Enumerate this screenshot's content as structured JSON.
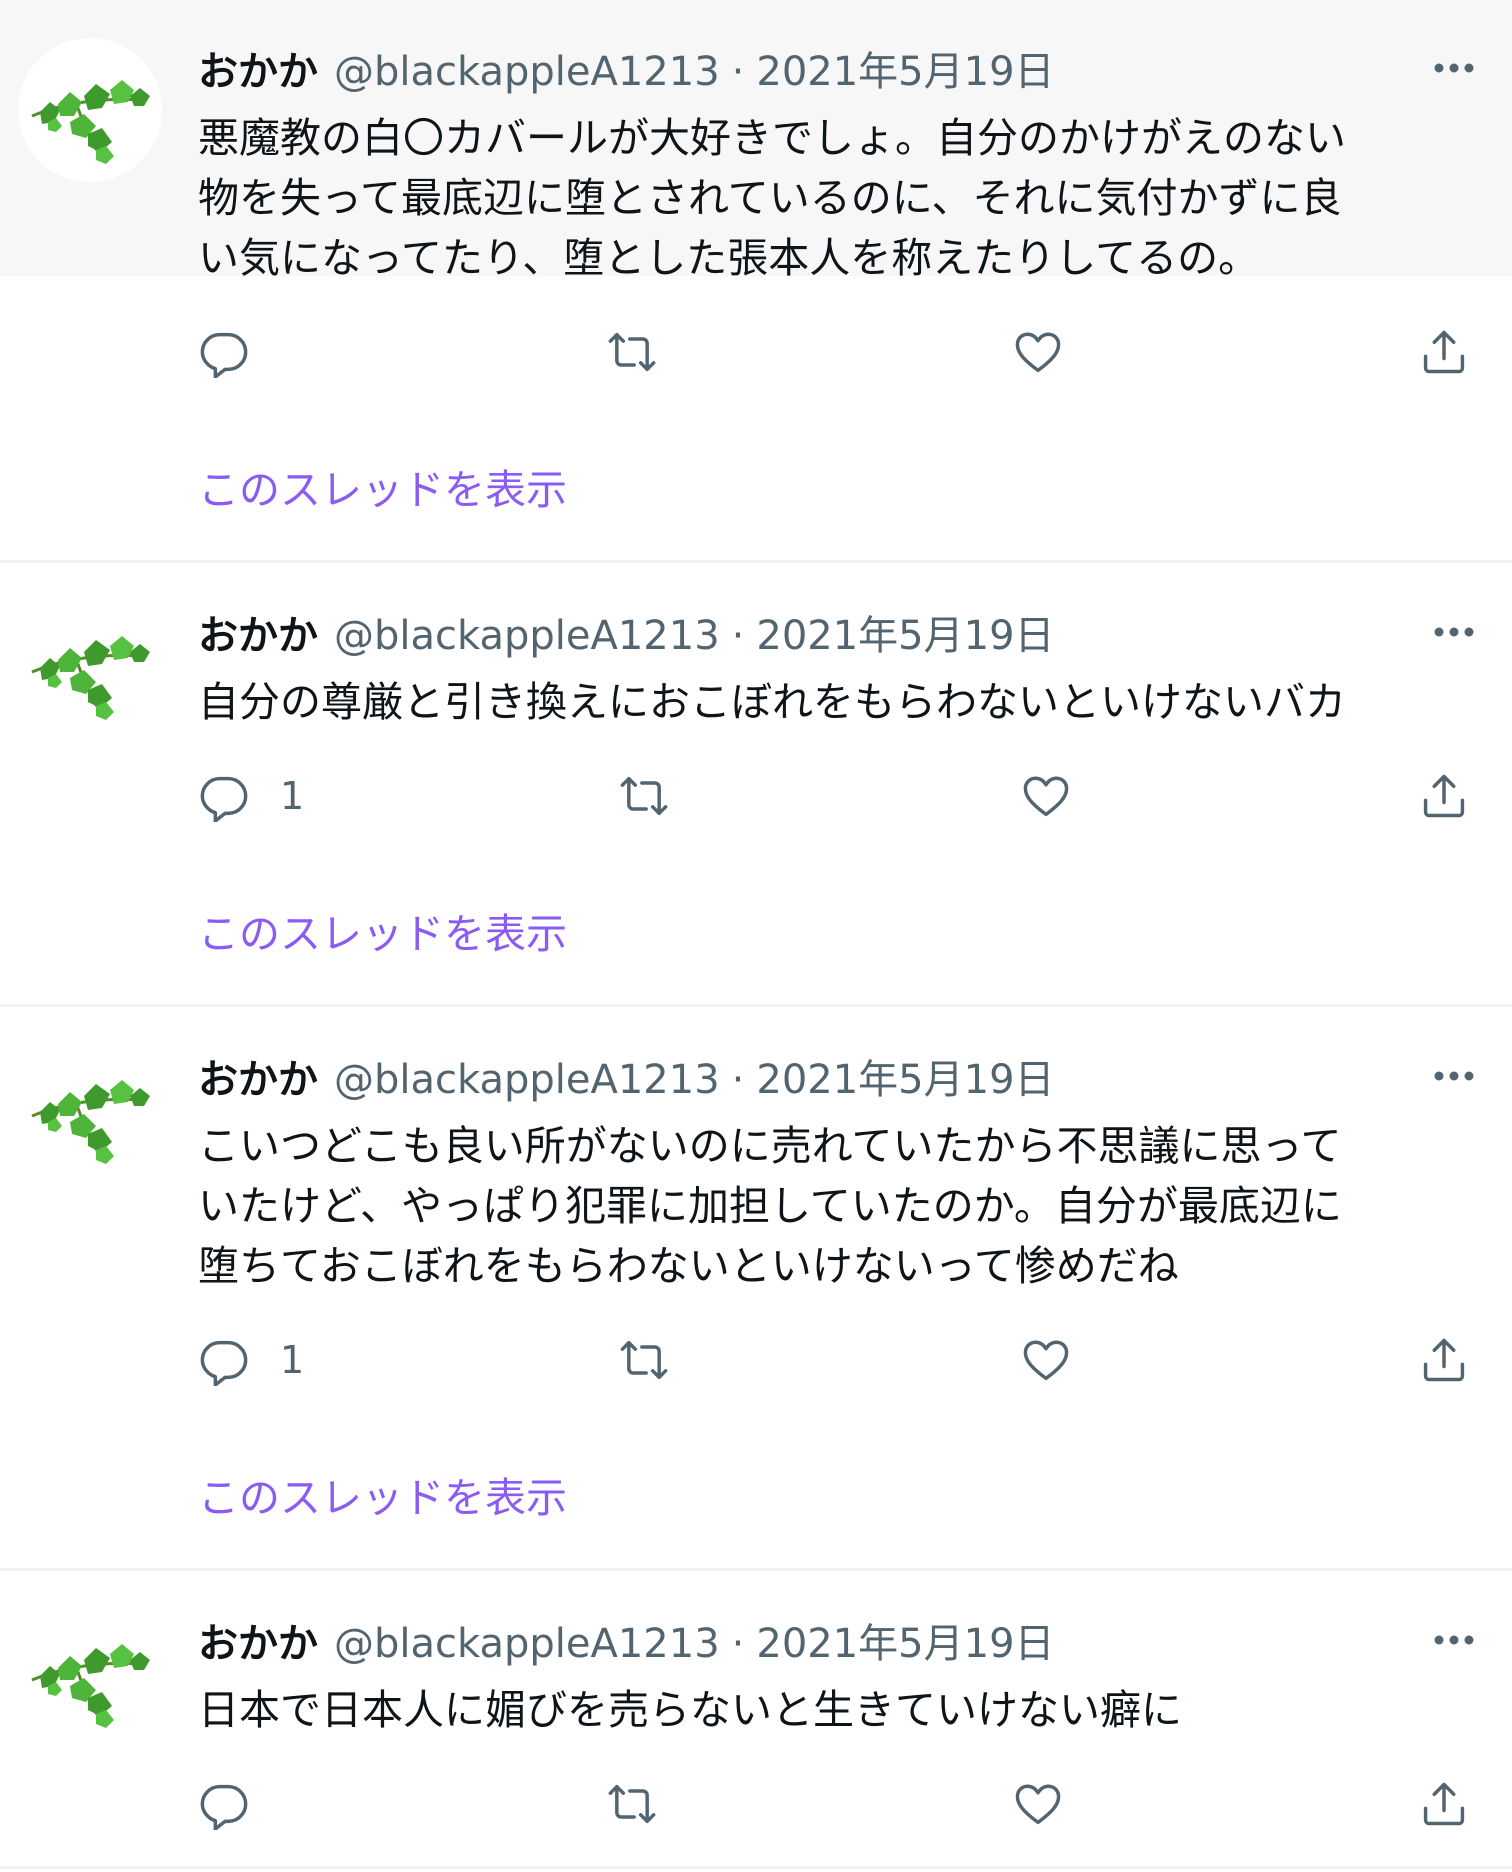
{
  "colors": {
    "link": "#8a5cf5",
    "secondary_text": "#536471",
    "primary_text": "#0f1419",
    "highlight_bg": "#f7f7f7",
    "divider": "#eff3f4",
    "leaf_green": "#3f9a2e"
  },
  "icons": {
    "avatar": "green-ivy-leaves-icon",
    "more": "more-dots-icon",
    "reply": "reply-bubble-icon",
    "retweet": "retweet-arrows-icon",
    "like": "heart-icon",
    "share": "share-upload-icon"
  },
  "tweets": [
    {
      "name": "おかか",
      "handle": "@blackappleA1213",
      "separator": "·",
      "date": "2021年5月19日",
      "text": "悪魔教の白〇カバールが大好きでしょ。自分のかけがえのない\n物を失って最底辺に堕とされているのに、それに気付かずに良\nい気になってたり、堕とした張本人を称えたりしてるの。",
      "reply_count": "",
      "thread_link": "このスレッドを表示"
    },
    {
      "name": "おかか",
      "handle": "@blackappleA1213",
      "separator": "·",
      "date": "2021年5月19日",
      "text": "自分の尊厳と引き換えにおこぼれをもらわないといけないバカ",
      "reply_count": "1",
      "thread_link": "このスレッドを表示"
    },
    {
      "name": "おかか",
      "handle": "@blackappleA1213",
      "separator": "·",
      "date": "2021年5月19日",
      "text": "こいつどこも良い所がないのに売れていたから不思議に思って\nいたけど、やっぱり犯罪に加担していたのか。自分が最底辺に\n堕ちておこぼれをもらわないといけないって惨めだね",
      "reply_count": "1",
      "thread_link": "このスレッドを表示"
    },
    {
      "name": "おかか",
      "handle": "@blackappleA1213",
      "separator": "·",
      "date": "2021年5月19日",
      "text": "日本で日本人に媚びを売らないと生きていけない癖に",
      "reply_count": ""
    }
  ]
}
